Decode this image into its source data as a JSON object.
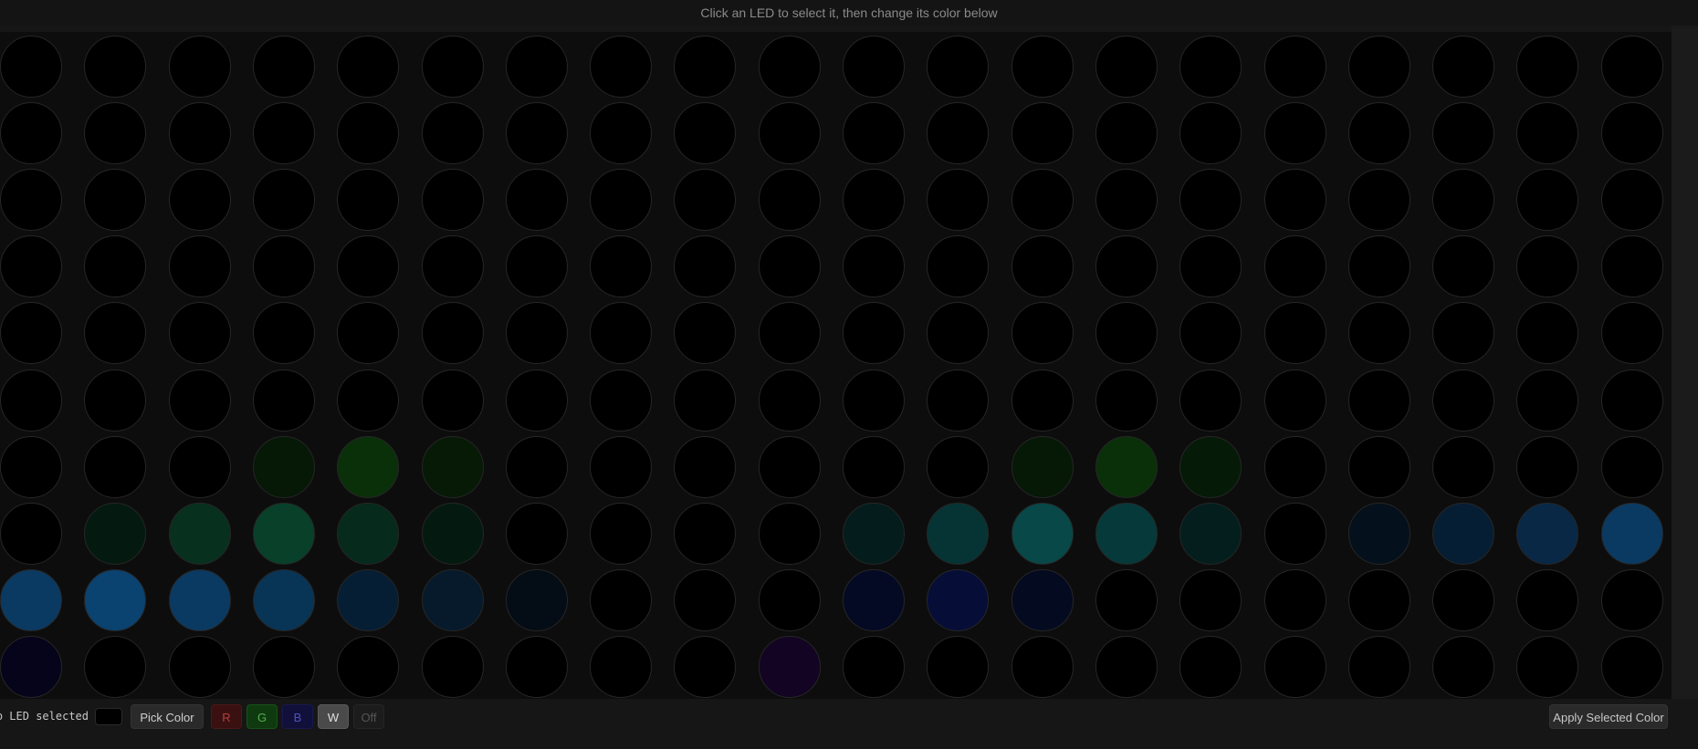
{
  "hint": "Click an LED to select it, then change its color below",
  "status": {
    "selection_text": "No LED selected",
    "current_color": "#000000"
  },
  "controls": {
    "pick_color_label": "Pick Color",
    "channels": [
      {
        "label": "R",
        "color": "#ff0000"
      },
      {
        "label": "G",
        "color": "#00ff00"
      },
      {
        "label": "B",
        "color": "#0000ff"
      },
      {
        "label": "W",
        "color": "#ffffff"
      },
      {
        "label": "Off",
        "color": "#000000"
      }
    ],
    "apply_label": "Apply Selected Color"
  },
  "led_matrix": {
    "rows": 10,
    "cols": 20,
    "colors": [
      [
        "#000000",
        "#000000",
        "#000000",
        "#000000",
        "#000000",
        "#000000",
        "#000000",
        "#000000",
        "#000000",
        "#000000",
        "#000000",
        "#000000",
        "#000000",
        "#000000",
        "#000000",
        "#000000",
        "#000000",
        "#000000",
        "#000000",
        "#000000"
      ],
      [
        "#000000",
        "#000000",
        "#000000",
        "#000000",
        "#000000",
        "#000000",
        "#000000",
        "#000000",
        "#000000",
        "#000000",
        "#000000",
        "#000000",
        "#000000",
        "#000000",
        "#000000",
        "#000000",
        "#000000",
        "#000000",
        "#000000",
        "#000000"
      ],
      [
        "#000000",
        "#000000",
        "#000000",
        "#000000",
        "#000000",
        "#000000",
        "#000000",
        "#000000",
        "#000000",
        "#000000",
        "#000000",
        "#000000",
        "#000000",
        "#000000",
        "#000000",
        "#000000",
        "#000000",
        "#000000",
        "#000000",
        "#000000"
      ],
      [
        "#000000",
        "#000000",
        "#000000",
        "#000000",
        "#000000",
        "#000000",
        "#000000",
        "#000000",
        "#000000",
        "#000000",
        "#000000",
        "#000000",
        "#000000",
        "#000000",
        "#000000",
        "#000000",
        "#000000",
        "#000000",
        "#000000",
        "#000000"
      ],
      [
        "#000000",
        "#000000",
        "#000000",
        "#000000",
        "#000000",
        "#000000",
        "#000000",
        "#000000",
        "#000000",
        "#000000",
        "#000000",
        "#000000",
        "#000000",
        "#000000",
        "#000000",
        "#000000",
        "#000000",
        "#000000",
        "#000000",
        "#000000"
      ],
      [
        "#000000",
        "#000000",
        "#000000",
        "#000000",
        "#000000",
        "#000000",
        "#000000",
        "#000000",
        "#000000",
        "#000000",
        "#000000",
        "#000000",
        "#000000",
        "#000000",
        "#000000",
        "#000000",
        "#000000",
        "#000000",
        "#000000",
        "#000000"
      ],
      [
        "#000000",
        "#000000",
        "#000000",
        "#061806",
        "#0a300a",
        "#061a06",
        "#000000",
        "#000000",
        "#000000",
        "#000000",
        "#000000",
        "#000000",
        "#061806",
        "#0a300a",
        "#061a08",
        "#000000",
        "#000000",
        "#000000",
        "#000000",
        "#000000"
      ],
      [
        "#000000",
        "#041a10",
        "#07301f",
        "#08402a",
        "#062a1c",
        "#041a10",
        "#000000",
        "#000000",
        "#000000",
        "#000000",
        "#041c1c",
        "#063434",
        "#084848",
        "#063a3a",
        "#041e1e",
        "#000000",
        "#04101c",
        "#061e34",
        "#082846",
        "#0a3a62"
      ],
      [
        "#0a3a62",
        "#0a4270",
        "#0a3a62",
        "#083456",
        "#061e34",
        "#061a2c",
        "#040c16",
        "#000000",
        "#000000",
        "#000000",
        "#040a24",
        "#060e38",
        "#040a20",
        "#000000",
        "#000000",
        "#000000",
        "#000000",
        "#000000",
        "#000000",
        "#000000"
      ],
      [
        "#06041a",
        "#000000",
        "#000000",
        "#000000",
        "#000000",
        "#000000",
        "#000000",
        "#000000",
        "#000000",
        "#120422",
        "#000000",
        "#000000",
        "#000000",
        "#000000",
        "#000000",
        "#000000",
        "#000000",
        "#000000",
        "#000000",
        "#000000"
      ]
    ]
  }
}
